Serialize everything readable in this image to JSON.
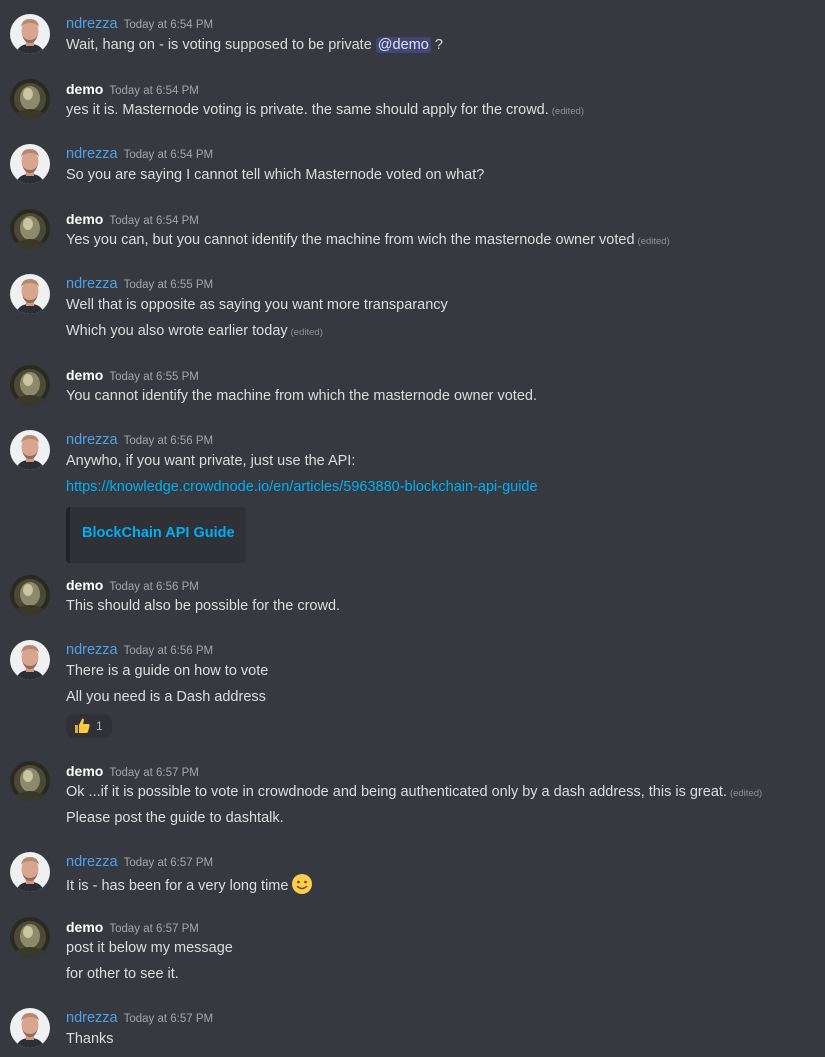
{
  "messages": [
    {
      "author": "ndrezza",
      "time": "Today at 6:54 PM",
      "lines": [
        {
          "pre": "Wait, hang on - is voting supposed to be private ",
          "mention": "@demo",
          "post": " ?"
        }
      ]
    },
    {
      "author": "demo",
      "time": "Today at 6:54 PM",
      "lines": [
        {
          "text": "yes it is. Masternode voting is private. the same should apply for the crowd.",
          "edited": "(edited)"
        }
      ]
    },
    {
      "author": "ndrezza",
      "time": "Today at 6:54 PM",
      "lines": [
        {
          "text": "So you are saying I cannot tell which Masternode voted on what?"
        }
      ]
    },
    {
      "author": "demo",
      "time": "Today at 6:54 PM",
      "lines": [
        {
          "text": "Yes you can, but you cannot identify the machine from wich the masternode owner voted",
          "edited": "(edited)"
        }
      ]
    },
    {
      "author": "ndrezza",
      "time": "Today at 6:55 PM",
      "lines": [
        {
          "text": "Well that is opposite as saying you want more transparancy"
        },
        {
          "text": "Which you also wrote earlier today",
          "edited": "(edited)"
        }
      ]
    },
    {
      "author": "demo",
      "time": "Today at 6:55 PM",
      "lines": [
        {
          "text": "You cannot identify the machine from which the masternode owner voted."
        }
      ]
    },
    {
      "author": "ndrezza",
      "time": "Today at 6:56 PM",
      "lines": [
        {
          "text": "Anywho, if you want private, just use the API:"
        },
        {
          "link": "https://knowledge.crowdnode.io/en/articles/5963880-blockchain-api-guide"
        }
      ],
      "embed": {
        "title": "BlockChain API Guide"
      }
    },
    {
      "author": "demo",
      "time": "Today at 6:56 PM",
      "lines": [
        {
          "text": "This should also be possible for the crowd."
        }
      ]
    },
    {
      "author": "ndrezza",
      "time": "Today at 6:56 PM",
      "lines": [
        {
          "text": "There is a guide on how to vote"
        },
        {
          "text": "All you need is a Dash address"
        }
      ],
      "reaction": {
        "emoji": "thumbs-up",
        "count": "1"
      }
    },
    {
      "author": "demo",
      "time": "Today at 6:57 PM",
      "lines": [
        {
          "text": "Ok ...if it is possible to vote in crowdnode and being authenticated only by a dash address, this is great.",
          "edited": "(edited)"
        },
        {
          "text": "Please post the guide to dashtalk."
        }
      ]
    },
    {
      "author": "ndrezza",
      "time": "Today at 6:57 PM",
      "lines": [
        {
          "text": "It is - has been for a very long time",
          "emoji": "slightly-smiling-face"
        }
      ]
    },
    {
      "author": "demo",
      "time": "Today at 6:57 PM",
      "lines": [
        {
          "text": "post it below my message"
        },
        {
          "text": "for other to see it."
        }
      ]
    },
    {
      "author": "ndrezza",
      "time": "Today at 6:57 PM",
      "lines": [
        {
          "text": "Thanks"
        }
      ]
    }
  ],
  "colors": {
    "background": "#36393f",
    "ndrezza": "#4fa2e8",
    "demo": "#ffffff",
    "link": "#00aff4",
    "mention_bg": "#414675"
  }
}
